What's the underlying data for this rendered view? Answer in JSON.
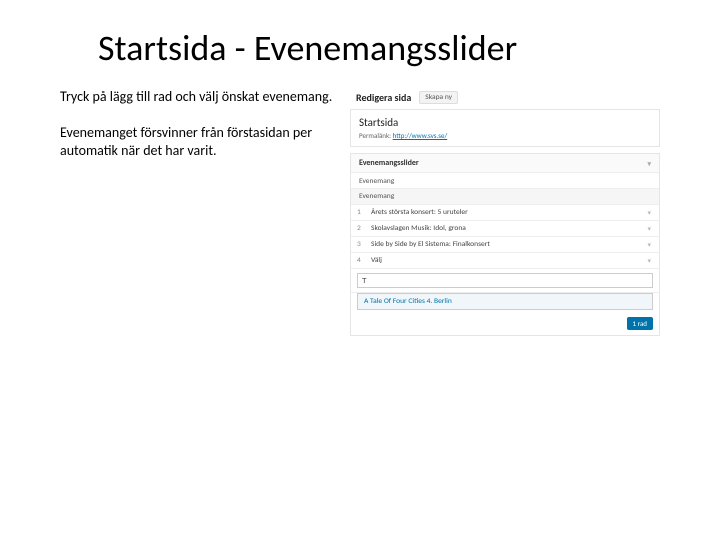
{
  "title": "Startsida - Evenemangsslider",
  "left": {
    "p1": "Tryck på lägg till rad och välj önskat evenemang.",
    "p2": "Evenemanget försvinner från förstasidan per automatik när det har varit."
  },
  "editor": {
    "heading": "Redigera sida",
    "new_btn": "Skapa ny",
    "page_title": "Startsida",
    "permalink_label": "Permalänk:",
    "permalink_url": "http://www.svs.se/",
    "box_title": "Evenemangsslider",
    "field_label": "Evenemang",
    "table_header": "Evenemang",
    "rows": [
      {
        "n": "1",
        "t": "Årets största konsert: 5 uruteler"
      },
      {
        "n": "2",
        "t": "Skolavslagen Musik: Idol, grona"
      },
      {
        "n": "3",
        "t": "Side by Side by El Sistema: Finalkonsert"
      }
    ],
    "row4_label": "Välj",
    "search_placeholder": "",
    "search_value": "T",
    "dropdown_option": "A Tale Of Four Cities 4. Berlin",
    "add_row_btn": "1 rad",
    "caret": "▾"
  }
}
